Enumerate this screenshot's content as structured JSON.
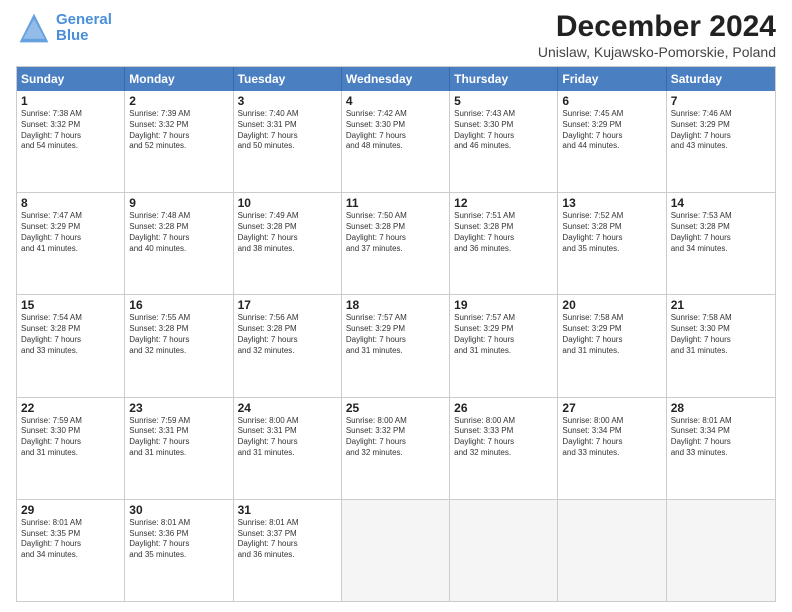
{
  "logo": {
    "line1": "General",
    "line2": "Blue"
  },
  "title": "December 2024",
  "subtitle": "Unislaw, Kujawsko-Pomorskie, Poland",
  "header_days": [
    "Sunday",
    "Monday",
    "Tuesday",
    "Wednesday",
    "Thursday",
    "Friday",
    "Saturday"
  ],
  "weeks": [
    [
      {
        "day": "1",
        "lines": [
          "Sunrise: 7:38 AM",
          "Sunset: 3:32 PM",
          "Daylight: 7 hours",
          "and 54 minutes."
        ]
      },
      {
        "day": "2",
        "lines": [
          "Sunrise: 7:39 AM",
          "Sunset: 3:32 PM",
          "Daylight: 7 hours",
          "and 52 minutes."
        ]
      },
      {
        "day": "3",
        "lines": [
          "Sunrise: 7:40 AM",
          "Sunset: 3:31 PM",
          "Daylight: 7 hours",
          "and 50 minutes."
        ]
      },
      {
        "day": "4",
        "lines": [
          "Sunrise: 7:42 AM",
          "Sunset: 3:30 PM",
          "Daylight: 7 hours",
          "and 48 minutes."
        ]
      },
      {
        "day": "5",
        "lines": [
          "Sunrise: 7:43 AM",
          "Sunset: 3:30 PM",
          "Daylight: 7 hours",
          "and 46 minutes."
        ]
      },
      {
        "day": "6",
        "lines": [
          "Sunrise: 7:45 AM",
          "Sunset: 3:29 PM",
          "Daylight: 7 hours",
          "and 44 minutes."
        ]
      },
      {
        "day": "7",
        "lines": [
          "Sunrise: 7:46 AM",
          "Sunset: 3:29 PM",
          "Daylight: 7 hours",
          "and 43 minutes."
        ]
      }
    ],
    [
      {
        "day": "8",
        "lines": [
          "Sunrise: 7:47 AM",
          "Sunset: 3:29 PM",
          "Daylight: 7 hours",
          "and 41 minutes."
        ]
      },
      {
        "day": "9",
        "lines": [
          "Sunrise: 7:48 AM",
          "Sunset: 3:28 PM",
          "Daylight: 7 hours",
          "and 40 minutes."
        ]
      },
      {
        "day": "10",
        "lines": [
          "Sunrise: 7:49 AM",
          "Sunset: 3:28 PM",
          "Daylight: 7 hours",
          "and 38 minutes."
        ]
      },
      {
        "day": "11",
        "lines": [
          "Sunrise: 7:50 AM",
          "Sunset: 3:28 PM",
          "Daylight: 7 hours",
          "and 37 minutes."
        ]
      },
      {
        "day": "12",
        "lines": [
          "Sunrise: 7:51 AM",
          "Sunset: 3:28 PM",
          "Daylight: 7 hours",
          "and 36 minutes."
        ]
      },
      {
        "day": "13",
        "lines": [
          "Sunrise: 7:52 AM",
          "Sunset: 3:28 PM",
          "Daylight: 7 hours",
          "and 35 minutes."
        ]
      },
      {
        "day": "14",
        "lines": [
          "Sunrise: 7:53 AM",
          "Sunset: 3:28 PM",
          "Daylight: 7 hours",
          "and 34 minutes."
        ]
      }
    ],
    [
      {
        "day": "15",
        "lines": [
          "Sunrise: 7:54 AM",
          "Sunset: 3:28 PM",
          "Daylight: 7 hours",
          "and 33 minutes."
        ]
      },
      {
        "day": "16",
        "lines": [
          "Sunrise: 7:55 AM",
          "Sunset: 3:28 PM",
          "Daylight: 7 hours",
          "and 32 minutes."
        ]
      },
      {
        "day": "17",
        "lines": [
          "Sunrise: 7:56 AM",
          "Sunset: 3:28 PM",
          "Daylight: 7 hours",
          "and 32 minutes."
        ]
      },
      {
        "day": "18",
        "lines": [
          "Sunrise: 7:57 AM",
          "Sunset: 3:29 PM",
          "Daylight: 7 hours",
          "and 31 minutes."
        ]
      },
      {
        "day": "19",
        "lines": [
          "Sunrise: 7:57 AM",
          "Sunset: 3:29 PM",
          "Daylight: 7 hours",
          "and 31 minutes."
        ]
      },
      {
        "day": "20",
        "lines": [
          "Sunrise: 7:58 AM",
          "Sunset: 3:29 PM",
          "Daylight: 7 hours",
          "and 31 minutes."
        ]
      },
      {
        "day": "21",
        "lines": [
          "Sunrise: 7:58 AM",
          "Sunset: 3:30 PM",
          "Daylight: 7 hours",
          "and 31 minutes."
        ]
      }
    ],
    [
      {
        "day": "22",
        "lines": [
          "Sunrise: 7:59 AM",
          "Sunset: 3:30 PM",
          "Daylight: 7 hours",
          "and 31 minutes."
        ]
      },
      {
        "day": "23",
        "lines": [
          "Sunrise: 7:59 AM",
          "Sunset: 3:31 PM",
          "Daylight: 7 hours",
          "and 31 minutes."
        ]
      },
      {
        "day": "24",
        "lines": [
          "Sunrise: 8:00 AM",
          "Sunset: 3:31 PM",
          "Daylight: 7 hours",
          "and 31 minutes."
        ]
      },
      {
        "day": "25",
        "lines": [
          "Sunrise: 8:00 AM",
          "Sunset: 3:32 PM",
          "Daylight: 7 hours",
          "and 32 minutes."
        ]
      },
      {
        "day": "26",
        "lines": [
          "Sunrise: 8:00 AM",
          "Sunset: 3:33 PM",
          "Daylight: 7 hours",
          "and 32 minutes."
        ]
      },
      {
        "day": "27",
        "lines": [
          "Sunrise: 8:00 AM",
          "Sunset: 3:34 PM",
          "Daylight: 7 hours",
          "and 33 minutes."
        ]
      },
      {
        "day": "28",
        "lines": [
          "Sunrise: 8:01 AM",
          "Sunset: 3:34 PM",
          "Daylight: 7 hours",
          "and 33 minutes."
        ]
      }
    ],
    [
      {
        "day": "29",
        "lines": [
          "Sunrise: 8:01 AM",
          "Sunset: 3:35 PM",
          "Daylight: 7 hours",
          "and 34 minutes."
        ]
      },
      {
        "day": "30",
        "lines": [
          "Sunrise: 8:01 AM",
          "Sunset: 3:36 PM",
          "Daylight: 7 hours",
          "and 35 minutes."
        ]
      },
      {
        "day": "31",
        "lines": [
          "Sunrise: 8:01 AM",
          "Sunset: 3:37 PM",
          "Daylight: 7 hours",
          "and 36 minutes."
        ]
      },
      {
        "day": "",
        "lines": []
      },
      {
        "day": "",
        "lines": []
      },
      {
        "day": "",
        "lines": []
      },
      {
        "day": "",
        "lines": []
      }
    ]
  ]
}
